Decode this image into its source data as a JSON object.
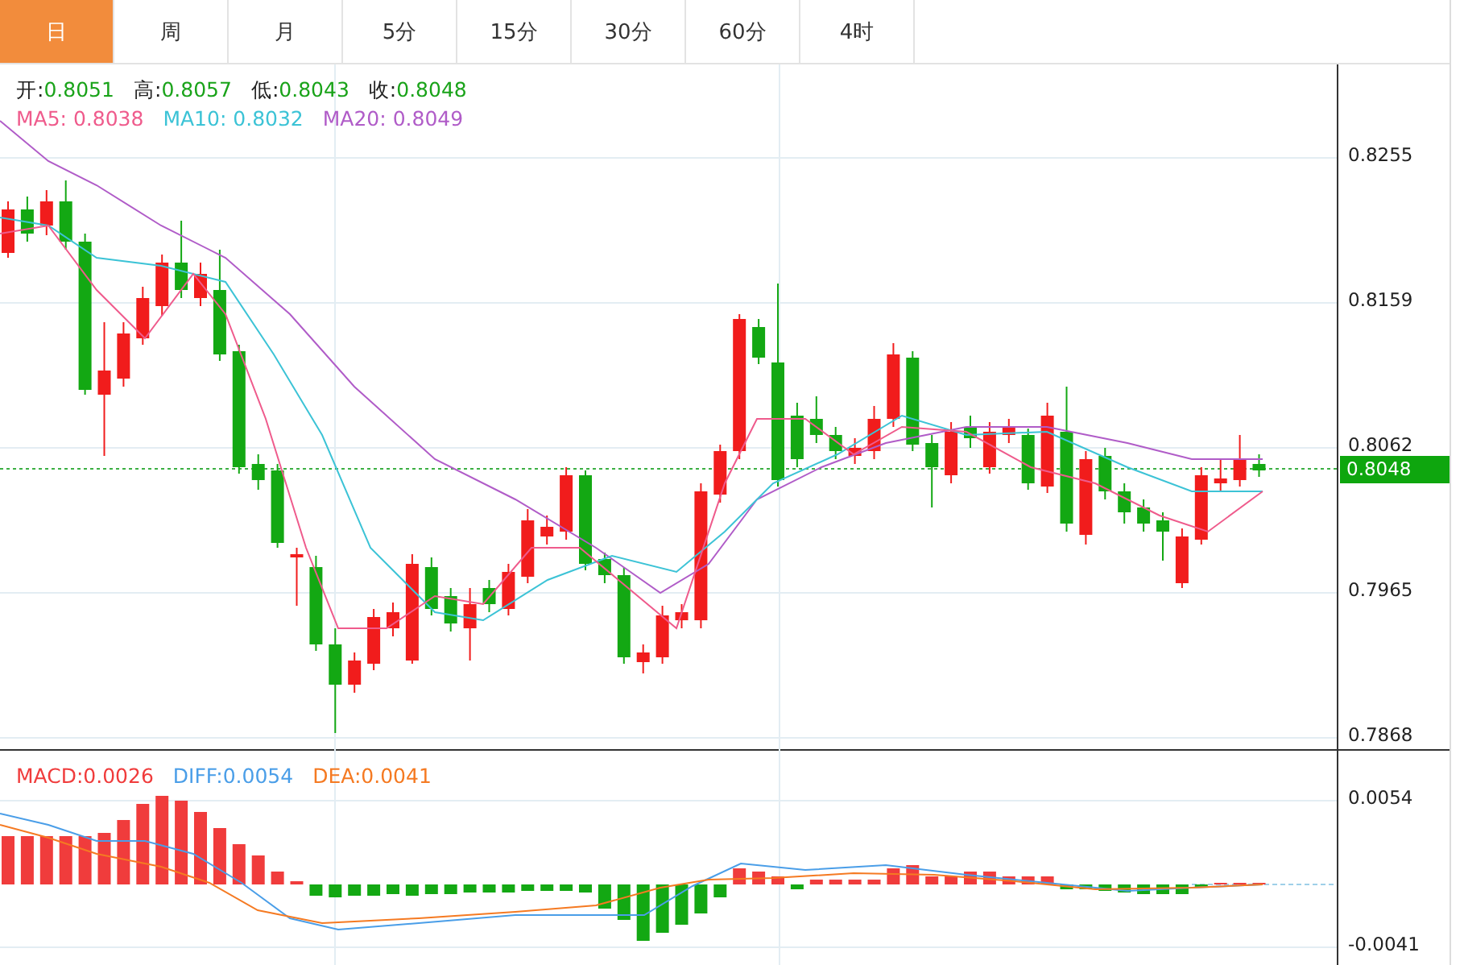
{
  "tabs": [
    {
      "label": "日",
      "selected": true
    },
    {
      "label": "周",
      "selected": false
    },
    {
      "label": "月",
      "selected": false
    },
    {
      "label": "5分",
      "selected": false
    },
    {
      "label": "15分",
      "selected": false
    },
    {
      "label": "30分",
      "selected": false
    },
    {
      "label": "60分",
      "selected": false
    },
    {
      "label": "4时",
      "selected": false
    }
  ],
  "price_chart": {
    "quote": [
      {
        "label": "开:",
        "value": "0.8051"
      },
      {
        "label": "高:",
        "value": "0.8057"
      },
      {
        "label": "低:",
        "value": "0.8043"
      },
      {
        "label": "收:",
        "value": "0.8048"
      }
    ],
    "averages": [
      {
        "text": "MA5: 0.8038",
        "color": "#ef5b8c"
      },
      {
        "text": "MA10: 0.8032",
        "color": "#3cc3d6"
      },
      {
        "text": "MA20: 0.8049",
        "color": "#b05cc8"
      }
    ],
    "axis_labels": [
      "0.8255",
      "0.8159",
      "0.8062",
      "0.7965",
      "0.7868"
    ],
    "current_price": "0.8048"
  },
  "macd_chart": {
    "legend": [
      {
        "text": "MACD:0.0026",
        "color": "#f03c3c"
      },
      {
        "text": "DIFF:0.0054",
        "color": "#4a9ee8"
      },
      {
        "text": "DEA:0.0041",
        "color": "#f57a22"
      }
    ],
    "axis_labels": [
      "0.0054",
      "-0.0041"
    ]
  }
}
